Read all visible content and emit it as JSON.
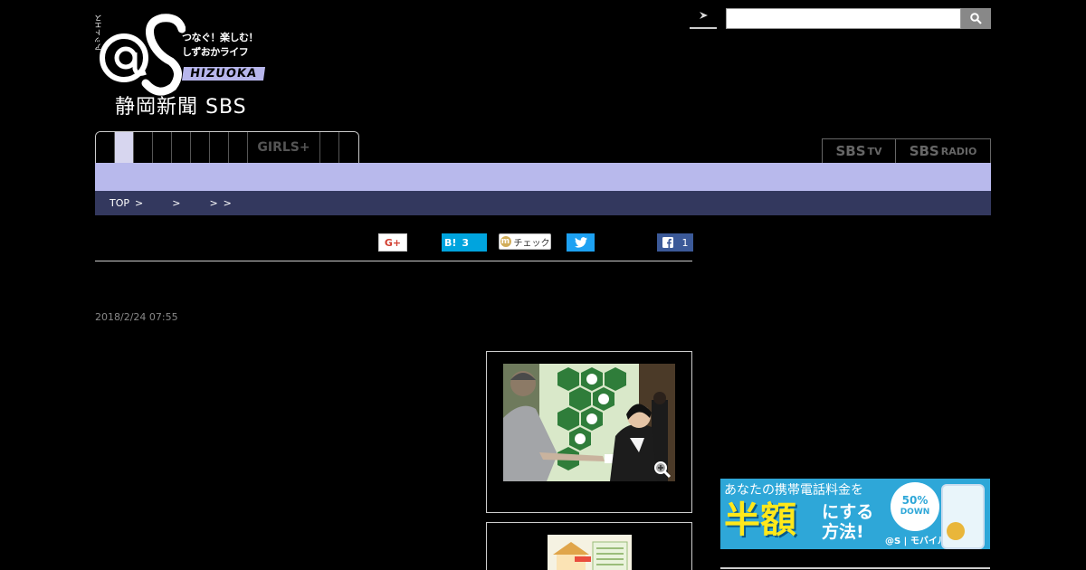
{
  "logo": {
    "katakana": "アットエス",
    "tagline_1": "つなぐ！楽しむ！",
    "tagline_2": "しずおかライフ",
    "region": "HIZUOKA",
    "publisher": "静岡新聞 SBS"
  },
  "search": {
    "value": "",
    "placeholder": ""
  },
  "nav": {
    "girls_label": "GIRLS+"
  },
  "external": {
    "tv": "SBS",
    "tv_suffix": "TV",
    "radio": "SBS",
    "radio_suffix": "RADIO"
  },
  "breadcrumb": {
    "top": "TOP",
    "sep": ">"
  },
  "share": {
    "gplus": "G+",
    "hatena": "B!",
    "hatena_count": "3",
    "mixi_icon": "m",
    "mixi": "チェック",
    "fb_count": "1"
  },
  "article": {
    "date": "2018/2/24 07:55"
  },
  "ad": {
    "line_1": "あなたの携帯電話料金を",
    "main": "半額",
    "sub_1": "にする",
    "sub_2": "方法!",
    "badge_pct": "50%",
    "badge_word": "DOWN",
    "brand": "@S | モバイル"
  },
  "colors": {
    "nav_band": "#b8b9ec",
    "breadcrumb_bg": "#33385e",
    "active_tab": "#d7d6ef",
    "ad_bg": "#2ea7d8"
  }
}
